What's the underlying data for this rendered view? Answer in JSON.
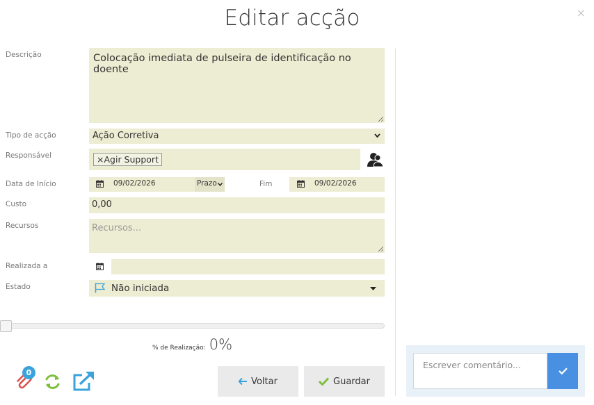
{
  "modal": {
    "title": "Editar acção",
    "close_label": "×"
  },
  "form": {
    "descricao": {
      "label": "Descrição",
      "value": "Colocação imediata de pulseira de identificação no doente"
    },
    "tipo": {
      "label": "Tipo de acção",
      "value": "Ação Corretiva"
    },
    "responsavel": {
      "label": "Responsável",
      "tag_remove": "×",
      "tag": "Agir Support"
    },
    "data_inicio": {
      "label": "Data de Início",
      "value": "09/02/2026",
      "prazo": "Prazo"
    },
    "fim": {
      "label": "Fim",
      "value": "09/02/2026"
    },
    "custo": {
      "label": "Custo",
      "value": "0,00"
    },
    "recursos": {
      "label": "Recursos",
      "placeholder": "Recursos..."
    },
    "realizada": {
      "label": "Realizada a",
      "value": ""
    },
    "estado": {
      "label": "Estado",
      "value": "Não iniciada"
    }
  },
  "progress": {
    "label": "% de Realização:",
    "value": "0%",
    "fraction": 0
  },
  "footer": {
    "attachments_count": "0",
    "back_label": "Voltar",
    "save_label": "Guardar"
  },
  "comment": {
    "placeholder": "Escrever comentário..."
  },
  "colors": {
    "field_bg": "#ededd3",
    "accent": "#4a90e2",
    "icon_blue": "#3aa3dc",
    "icon_green": "#7cbf3b",
    "icon_red": "#d9534f"
  }
}
